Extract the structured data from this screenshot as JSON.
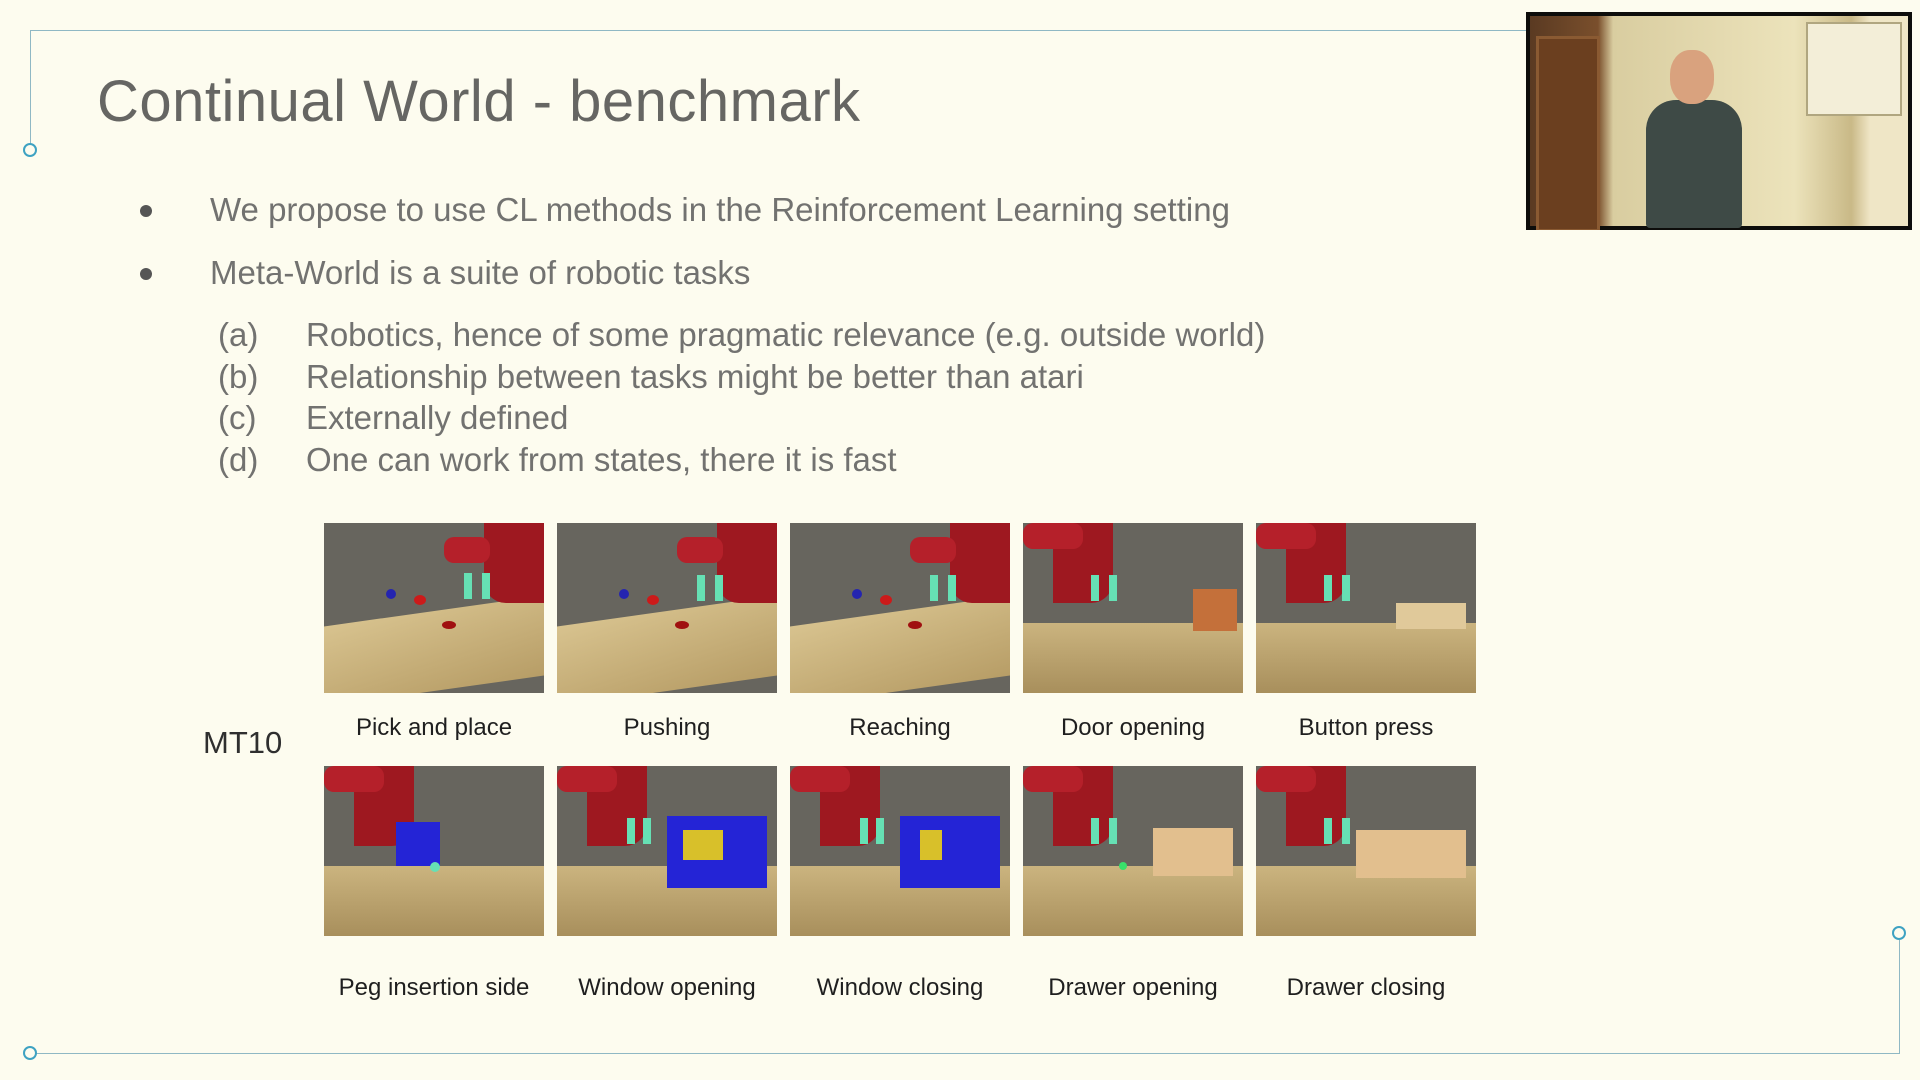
{
  "slide": {
    "title": "Continual World - benchmark",
    "bullets": [
      "We propose to use CL methods in the Reinforcement Learning setting",
      "Meta-World is a suite of robotic tasks"
    ],
    "subitems": [
      {
        "letter": "(a)",
        "text": "Robotics, hence of some pragmatic relevance (e.g. outside world)"
      },
      {
        "letter": "(b)",
        "text": "Relationship between tasks might be better than atari"
      },
      {
        "letter": "(c)",
        "text": "Externally defined"
      },
      {
        "letter": "(d)",
        "text": "One can work from states, there it is fast"
      }
    ],
    "mt_label": "MT10",
    "tasks": [
      "Pick and place",
      "Pushing",
      "Reaching",
      "Door opening",
      "Button press",
      "Peg insertion side",
      "Window opening",
      "Window closing",
      "Drawer opening",
      "Drawer closing"
    ]
  },
  "colors": {
    "background": "#fdfcef",
    "frame_accent": "#3ea2c2",
    "robot_red": "#9e1820",
    "gripper_green": "#66e0b4",
    "window_blue": "#2424d6"
  }
}
